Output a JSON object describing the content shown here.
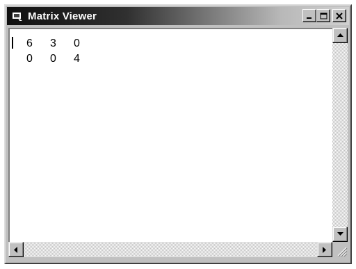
{
  "window": {
    "title": "Matrix Viewer",
    "title_bar_colors": [
      "#101010",
      "#d0d0d0"
    ],
    "caption_buttons": {
      "minimize_icon": "minimize-icon",
      "maximize_icon": "maximize-icon",
      "close_icon": "close-icon"
    }
  },
  "content": {
    "matrix": [
      [
        "6",
        "3",
        "0"
      ],
      [
        "0",
        "0",
        "4"
      ]
    ]
  },
  "scrollbars": {
    "vertical": {
      "up_icon": "arrow-up-icon",
      "down_icon": "arrow-down-icon"
    },
    "horizontal": {
      "left_icon": "arrow-left-icon",
      "right_icon": "arrow-right-icon"
    }
  }
}
